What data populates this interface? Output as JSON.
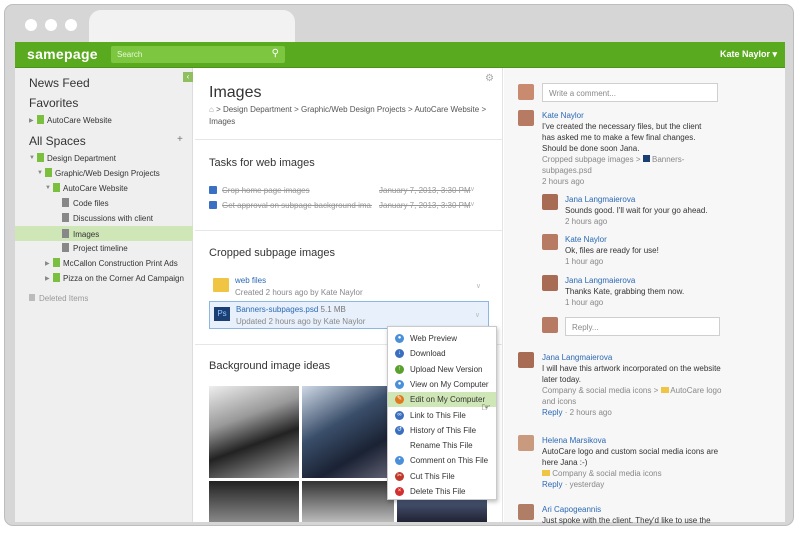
{
  "app": {
    "logo": "samepage",
    "search_placeholder": "Search",
    "user": "Kate Naylor ▾"
  },
  "sidebar": {
    "news_feed": "News Feed",
    "favorites": "Favorites",
    "fav_item": "AutoCare Website",
    "all_spaces": "All Spaces",
    "add": "+",
    "items": [
      {
        "label": "Design Department"
      },
      {
        "label": "Graphic/Web Design Projects"
      },
      {
        "label": "AutoCare Website"
      },
      {
        "label": "Code files"
      },
      {
        "label": "Discussions with client"
      },
      {
        "label": "Images"
      },
      {
        "label": "Project timeline"
      },
      {
        "label": "McCallon Construction Print Ads"
      },
      {
        "label": "Pizza on the Corner Ad Campaign"
      }
    ],
    "deleted": "Deleted Items"
  },
  "page": {
    "title": "Images",
    "breadcrumb": "> Design Department > Graphic/Web Design Projects > AutoCare Website > Images",
    "tasks_title": "Tasks for web images",
    "tasks": [
      {
        "text": "Crop home page images",
        "date": "January 7, 2013, 3:30 PM"
      },
      {
        "text": "Get approval on subpage background ima...",
        "date": "January 7, 2013, 3:30 PM"
      }
    ],
    "cropped_title": "Cropped subpage images",
    "files": [
      {
        "name": "web files",
        "size": "",
        "sub": "Created 2 hours ago by Kate Naylor"
      },
      {
        "name": "Banners-subpages.psd",
        "size": "5.1 MB",
        "sub": "Updated 2 hours ago by Kate Naylor"
      }
    ],
    "bg_title": "Background image ideas"
  },
  "context_menu": [
    "Web Preview",
    "Download",
    "Upload New Version",
    "View on My Computer",
    "Edit on My Computer",
    "Link to This File",
    "History of This File",
    "Rename This File",
    "Comment on This File",
    "Cut This File",
    "Delete This File"
  ],
  "comments": {
    "placeholder": "Write a comment...",
    "c1": {
      "name": "Kate Naylor",
      "text": "I've created the necessary files, but the client has asked me to make a few final changes. Should be done soon Jana.",
      "ref": "Cropped subpage images >",
      "ref_file": "Banners-subpages.psd",
      "time": "2 hours ago"
    },
    "r1": {
      "name": "Jana Langmaierova",
      "text": "Sounds good. I'll wait for your go ahead.",
      "time": "2 hours ago"
    },
    "r2": {
      "name": "Kate Naylor",
      "text": "Ok, files are ready for use!",
      "time": "1 hour ago"
    },
    "r3": {
      "name": "Jana Langmaierova",
      "text": "Thanks Kate, grabbing them now.",
      "time": "1 hour ago"
    },
    "reply_placeholder": "Reply...",
    "c2": {
      "name": "Jana Langmaierova",
      "text": "I will have this artwork incorporated on the website later today.",
      "ref": "Company & social media icons >",
      "ref_file": "AutoCare logo and icons",
      "reply": "Reply",
      "time": "· 2 hours ago"
    },
    "c3": {
      "name": "Helena Marsikova",
      "text": "AutoCare logo and custom social media icons are here Jana :-)",
      "ref_file": "Company & social media icons",
      "reply": "Reply",
      "time": "· yesterday"
    },
    "c4": {
      "name": "Ari Capogeannis",
      "text": "Just spoke with the client. They'd like to use the"
    }
  },
  "colors": {
    "brand": "#5aaa1f",
    "link": "#2b69b4",
    "selected": "#cfe6b6"
  }
}
